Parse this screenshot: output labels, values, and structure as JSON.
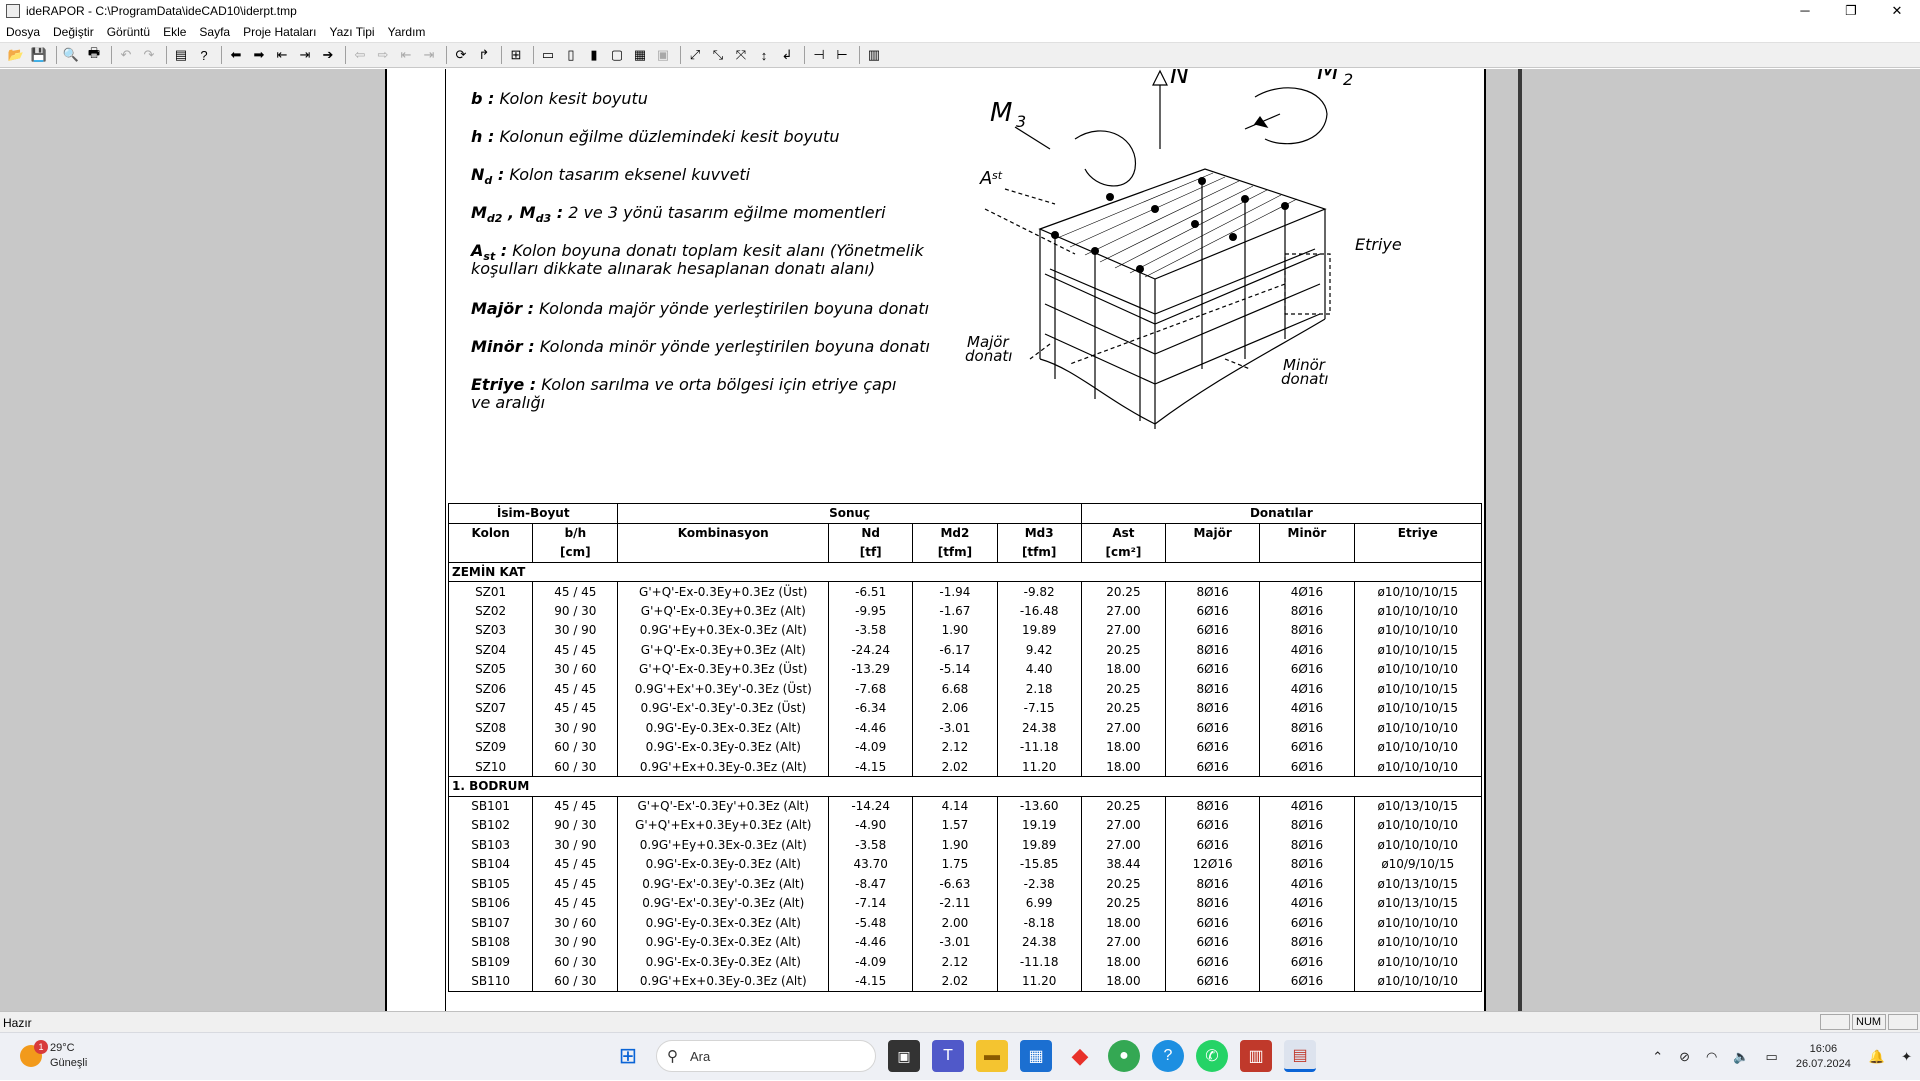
{
  "window": {
    "title": "ideRAPOR - C:\\ProgramData\\ideCAD10\\iderpt.tmp",
    "minimize": "─",
    "restore": "❐",
    "close": "✕"
  },
  "menu": [
    "Dosya",
    "Değiştir",
    "Görüntü",
    "Ekle",
    "Sayfa",
    "Proje Hataları",
    "Yazı Tipi",
    "Yardım"
  ],
  "legend": [
    {
      "term": "b :",
      "desc": "Kolon kesit boyutu"
    },
    {
      "term": "h :",
      "desc": "Kolonun eğilme düzlemindeki kesit boyutu"
    },
    {
      "term": "N",
      "sub": "d",
      "term2": " :",
      "desc": "Kolon tasarım eksenel kuvveti"
    },
    {
      "term": "M",
      "sub": "d2",
      "mid": " , M",
      "sub2": "d3",
      "term2": " :",
      "desc": "2  ve 3 yönü tasarım eğilme momentleri"
    },
    {
      "term": "A",
      "sub": "st",
      "term2": " :",
      "desc": "Kolon boyuna donatı toplam kesit alanı (Yönetmelik",
      "desc2": "koşulları dikkate alınarak hesaplanan donatı alanı)"
    },
    {
      "term": "Majör :",
      "desc": "Kolonda majör yönde yerleştirilen boyuna donatı"
    },
    {
      "term": "Minör :",
      "desc": "Kolonda minör yönde yerleştirilen boyuna donatı"
    },
    {
      "term": "Etriye :",
      "desc": "Kolon sarılma ve orta bölgesi için etriye çapı",
      "desc2": "ve aralığı"
    }
  ],
  "diagram": {
    "N": "N",
    "M2": "M",
    "M2sub": "2",
    "M3": "M",
    "M3sub": "3",
    "Ast": "A",
    "Astsub": "st",
    "etriye": "Etriye",
    "major1": "Majör",
    "major2": "donatı",
    "minor1": "Minör",
    "minor2": "donatı"
  },
  "table": {
    "groups": [
      "İsim-Boyut",
      "Sonuç",
      "Donatılar"
    ],
    "headers": [
      "Kolon",
      "b/h",
      "Kombinasyon",
      "Nd",
      "Md2",
      "Md3",
      "Ast",
      "Majör",
      "Minör",
      "Etriye"
    ],
    "units": [
      "",
      "[cm]",
      "",
      "[tf]",
      "[tfm]",
      "[tfm]",
      "[cm²]",
      "",
      "",
      ""
    ],
    "sections": [
      {
        "name": "ZEMİN KAT",
        "rows": [
          [
            "SZ01",
            "45 / 45",
            "G'+Q'-Ex-0.3Ey+0.3Ez (Üst)",
            "-6.51",
            "-1.94",
            "-9.82",
            "20.25",
            "8Ø16",
            "4Ø16",
            "ø10/10/10/15"
          ],
          [
            "SZ02",
            "90 / 30",
            "G'+Q'-Ex-0.3Ey+0.3Ez (Alt)",
            "-9.95",
            "-1.67",
            "-16.48",
            "27.00",
            "6Ø16",
            "8Ø16",
            "ø10/10/10/10"
          ],
          [
            "SZ03",
            "30 / 90",
            "0.9G'+Ey+0.3Ex-0.3Ez (Alt)",
            "-3.58",
            "1.90",
            "19.89",
            "27.00",
            "6Ø16",
            "8Ø16",
            "ø10/10/10/10"
          ],
          [
            "SZ04",
            "45 / 45",
            "G'+Q'-Ex-0.3Ey+0.3Ez (Alt)",
            "-24.24",
            "-6.17",
            "9.42",
            "20.25",
            "8Ø16",
            "4Ø16",
            "ø10/10/10/15"
          ],
          [
            "SZ05",
            "30 / 60",
            "G'+Q'-Ex-0.3Ey+0.3Ez (Üst)",
            "-13.29",
            "-5.14",
            "4.40",
            "18.00",
            "6Ø16",
            "6Ø16",
            "ø10/10/10/10"
          ],
          [
            "SZ06",
            "45 / 45",
            "0.9G'+Ex'+0.3Ey'-0.3Ez (Üst)",
            "-7.68",
            "6.68",
            "2.18",
            "20.25",
            "8Ø16",
            "4Ø16",
            "ø10/10/10/15"
          ],
          [
            "SZ07",
            "45 / 45",
            "0.9G'-Ex'-0.3Ey'-0.3Ez (Üst)",
            "-6.34",
            "2.06",
            "-7.15",
            "20.25",
            "8Ø16",
            "4Ø16",
            "ø10/10/10/15"
          ],
          [
            "SZ08",
            "30 / 90",
            "0.9G'-Ey-0.3Ex-0.3Ez (Alt)",
            "-4.46",
            "-3.01",
            "24.38",
            "27.00",
            "6Ø16",
            "8Ø16",
            "ø10/10/10/10"
          ],
          [
            "SZ09",
            "60 / 30",
            "0.9G'-Ex-0.3Ey-0.3Ez (Alt)",
            "-4.09",
            "2.12",
            "-11.18",
            "18.00",
            "6Ø16",
            "6Ø16",
            "ø10/10/10/10"
          ],
          [
            "SZ10",
            "60 / 30",
            "0.9G'+Ex+0.3Ey-0.3Ez (Alt)",
            "-4.15",
            "2.02",
            "11.20",
            "18.00",
            "6Ø16",
            "6Ø16",
            "ø10/10/10/10"
          ]
        ]
      },
      {
        "name": "1. BODRUM",
        "rows": [
          [
            "SB101",
            "45 / 45",
            "G'+Q'-Ex'-0.3Ey'+0.3Ez (Alt)",
            "-14.24",
            "4.14",
            "-13.60",
            "20.25",
            "8Ø16",
            "4Ø16",
            "ø10/13/10/15"
          ],
          [
            "SB102",
            "90 / 30",
            "G'+Q'+Ex+0.3Ey+0.3Ez (Alt)",
            "-4.90",
            "1.57",
            "19.19",
            "27.00",
            "6Ø16",
            "8Ø16",
            "ø10/10/10/10"
          ],
          [
            "SB103",
            "30 / 90",
            "0.9G'+Ey+0.3Ex-0.3Ez (Alt)",
            "-3.58",
            "1.90",
            "19.89",
            "27.00",
            "6Ø16",
            "8Ø16",
            "ø10/10/10/10"
          ],
          [
            "SB104",
            "45 / 45",
            "0.9G'-Ex-0.3Ey-0.3Ez (Alt)",
            "43.70",
            "1.75",
            "-15.85",
            "38.44",
            "12Ø16",
            "8Ø16",
            "ø10/9/10/15"
          ],
          [
            "SB105",
            "45 / 45",
            "0.9G'-Ex'-0.3Ey'-0.3Ez (Alt)",
            "-8.47",
            "-6.63",
            "-2.38",
            "20.25",
            "8Ø16",
            "4Ø16",
            "ø10/13/10/15"
          ],
          [
            "SB106",
            "45 / 45",
            "0.9G'-Ex'-0.3Ey'-0.3Ez (Alt)",
            "-7.14",
            "-2.11",
            "6.99",
            "20.25",
            "8Ø16",
            "4Ø16",
            "ø10/13/10/15"
          ],
          [
            "SB107",
            "30 / 60",
            "0.9G'-Ey-0.3Ex-0.3Ez (Alt)",
            "-5.48",
            "2.00",
            "-8.18",
            "18.00",
            "6Ø16",
            "6Ø16",
            "ø10/10/10/10"
          ],
          [
            "SB108",
            "30 / 90",
            "0.9G'-Ey-0.3Ex-0.3Ez (Alt)",
            "-4.46",
            "-3.01",
            "24.38",
            "27.00",
            "6Ø16",
            "8Ø16",
            "ø10/10/10/10"
          ],
          [
            "SB109",
            "60 / 30",
            "0.9G'-Ex-0.3Ey-0.3Ez (Alt)",
            "-4.09",
            "2.12",
            "-11.18",
            "18.00",
            "6Ø16",
            "6Ø16",
            "ø10/10/10/10"
          ],
          [
            "SB110",
            "60 / 30",
            "0.9G'+Ex+0.3Ey-0.3Ez (Alt)",
            "-4.15",
            "2.02",
            "11.20",
            "18.00",
            "6Ø16",
            "6Ø16",
            "ø10/10/10/10"
          ]
        ]
      }
    ]
  },
  "status": {
    "text": "Hazır",
    "num": "NUM"
  },
  "taskbar": {
    "temp": "29°C",
    "weather": "Güneşli",
    "badge": "1",
    "search_placeholder": "Ara",
    "time": "16:06",
    "date": "26.07.2024"
  }
}
